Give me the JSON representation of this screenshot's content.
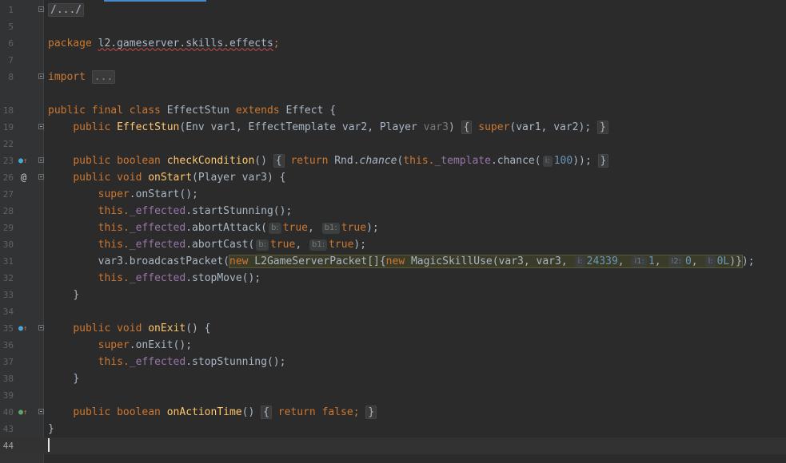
{
  "editor": {
    "line_numbers": [
      "1",
      "5",
      "6",
      "7",
      "8",
      "18",
      "19",
      "22",
      "23",
      "26",
      "27",
      "28",
      "29",
      "30",
      "31",
      "32",
      "33",
      "34",
      "35",
      "36",
      "37",
      "38",
      "39",
      "40",
      "43",
      "44"
    ],
    "l1_text": "/.../",
    "package_kw": "package",
    "package_name": "l2.gameserver.skills.effects",
    "package_semi": ";",
    "import_kw": "import",
    "import_folded": "...",
    "class_decl_kw": "public final class",
    "class_name": "EffectStun",
    "extends_kw": "extends",
    "super_class": "Effect {",
    "ctor_public": "public",
    "ctor_name": "EffectStun",
    "ctor_params_a": "(Env var1, EffectTemplate var2, Player ",
    "ctor_params_b": "var3",
    "ctor_params_c": ")",
    "ctor_open": "{",
    "ctor_super": "super",
    "ctor_args": "(var1, var2);",
    "ctor_close": "}",
    "cc_mods": "public boolean",
    "cc_name": "checkCondition",
    "cc_parens": "()",
    "cc_open": "{",
    "cc_return": "return",
    "cc_rnd": "Rnd.",
    "cc_chance": "chance",
    "cc_paren": "(",
    "cc_this": "this.",
    "cc_template": "_template",
    "cc_chance2": ".chance(",
    "cc_hint": "i:",
    "cc_num": "100",
    "cc_end": "));",
    "cc_close": "}",
    "os_mods": "public void",
    "os_name": "onStart",
    "os_params": "(Player var3) {",
    "super_kw": "super",
    "os_super_call": ".onStart();",
    "this_kw": "this.",
    "effected": "_effected",
    "start_stunning": ".startStunning();",
    "abort_attack": ".abortAttack(",
    "hint_b": "b:",
    "true_kw": "true",
    "comma": ", ",
    "hint_b1": "b1:",
    "close_semi": ");",
    "abort_cast": ".abortCast(",
    "bp_prefix": "var3.broadcastPacket(",
    "new_kw": "new",
    "bp_type": " L2GameServerPacket[]{",
    "bp_skill": " MagicSkillUse(var3, var3, ",
    "hint_i": "i:",
    "n_24339": "24339",
    "hint_i1": "i1:",
    "n_1": "1",
    "hint_i2": "i2:",
    "n_0": "0",
    "hint_l": "l:",
    "n_0L": "0L",
    "bp_end_hl": ")}",
    "bp_end": ");",
    "stop_move": ".stopMove();",
    "brace_close": "}",
    "oe_mods": "public void",
    "oe_name": "onExit",
    "oe_params": "() {",
    "oe_super_call": ".onExit();",
    "stop_stunning": ".stopStunning();",
    "oat_mods": "public boolean",
    "oat_name": "onActionTime",
    "oat_parens": "()",
    "oat_open": "{",
    "oat_return": "return",
    "false_kw": "false;",
    "oat_close": "}",
    "class_close": "}"
  },
  "gutter_icons": [
    "override-icon",
    "annotation-icon",
    "implement-icon"
  ]
}
